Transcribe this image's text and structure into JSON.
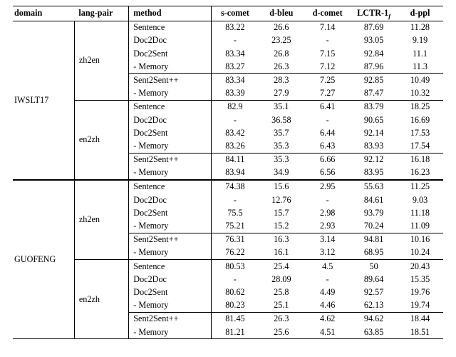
{
  "columns": {
    "c0": "domain",
    "c1": "lang-pair",
    "c2": "method",
    "c3": "s-comet",
    "c4": "d-bleu",
    "c5": "d-comet",
    "c6_prefix": "LCTR-1",
    "c6_sub": "f",
    "c7": "d-ppl"
  },
  "domains": [
    "IWSLT17",
    "GUOFENG"
  ],
  "langpairs": [
    "zh2en",
    "en2zh",
    "zh2en",
    "en2zh"
  ],
  "groups": [
    [
      [
        "Sentence",
        "83.22",
        "26.6",
        "7.14",
        "87.69",
        "11.28"
      ],
      [
        "Doc2Doc",
        "-",
        "23.25",
        "-",
        "93.05",
        "9.19"
      ],
      [
        "Doc2Sent",
        "83.34",
        "26.8",
        "7.15",
        "92.84",
        "11.1"
      ],
      [
        "  - Memory",
        "83.27",
        "26.3",
        "7.12",
        "87.96",
        "11.3"
      ]
    ],
    [
      [
        "Sent2Sent++",
        "83.34",
        "28.3",
        "7.25",
        "92.85",
        "10.49"
      ],
      [
        "  - Memory",
        "83.39",
        "27.9",
        "7.27",
        "87.47",
        "10.32"
      ]
    ],
    [
      [
        "Sentence",
        "82.9",
        "35.1",
        "6.41",
        "83.79",
        "18.25"
      ],
      [
        "Doc2Doc",
        "-",
        "36.58",
        "-",
        "90.65",
        "16.69"
      ],
      [
        "Doc2Sent",
        "83.42",
        "35.7",
        "6.44",
        "92.14",
        "17.53"
      ],
      [
        "  - Memory",
        "83.26",
        "35.3",
        "6.43",
        "83.93",
        "17.54"
      ]
    ],
    [
      [
        "Sent2Sent++",
        "84.11",
        "35.3",
        "6.66",
        "92.12",
        "16.18"
      ],
      [
        "  - Memory",
        "83.94",
        "34.9",
        "6.56",
        "83.95",
        "16.23"
      ]
    ],
    [
      [
        "Sentence",
        "74.38",
        "15.6",
        "2.95",
        "55.63",
        "11.25"
      ],
      [
        "Doc2Doc",
        "-",
        "12.76",
        "-",
        "84.61",
        "9.03"
      ],
      [
        "Doc2Sent",
        "75.5",
        "15.7",
        "2.98",
        "93.79",
        "11.18"
      ],
      [
        "  - Memory",
        "75.21",
        "15.2",
        "2.93",
        "70.24",
        "11.09"
      ]
    ],
    [
      [
        "Sent2Sent++",
        "76.31",
        "16.3",
        "3.14",
        "94.81",
        "10.16"
      ],
      [
        "  - Memory",
        "76.22",
        "16.1",
        "3.12",
        "68.95",
        "10.24"
      ]
    ],
    [
      [
        "Sentence",
        "80.53",
        "25.4",
        "4.5",
        "50",
        "20.43"
      ],
      [
        "Doc2Doc",
        "-",
        "28.09",
        "-",
        "89.64",
        "15.35"
      ],
      [
        "Doc2Sent",
        "80.62",
        "25.8",
        "4.49",
        "92.57",
        "19.76"
      ],
      [
        "  - Memory",
        "80.23",
        "25.1",
        "4.46",
        "62.13",
        "19.74"
      ]
    ],
    [
      [
        "Sent2Sent++",
        "81.45",
        "26.3",
        "4.62",
        "94.62",
        "18.44"
      ],
      [
        "  - Memory",
        "81.21",
        "25.6",
        "4.51",
        "63.85",
        "18.51"
      ]
    ]
  ],
  "chart_data": {
    "type": "table",
    "title": "",
    "columns": [
      "domain",
      "lang-pair",
      "method",
      "s-comet",
      "d-bleu",
      "d-comet",
      "LCTR-1_f",
      "d-ppl"
    ],
    "rows": [
      [
        "IWSLT17",
        "zh2en",
        "Sentence",
        83.22,
        26.6,
        7.14,
        87.69,
        11.28
      ],
      [
        "IWSLT17",
        "zh2en",
        "Doc2Doc",
        null,
        23.25,
        null,
        93.05,
        9.19
      ],
      [
        "IWSLT17",
        "zh2en",
        "Doc2Sent",
        83.34,
        26.8,
        7.15,
        92.84,
        11.1
      ],
      [
        "IWSLT17",
        "zh2en",
        "Doc2Sent - Memory",
        83.27,
        26.3,
        7.12,
        87.96,
        11.3
      ],
      [
        "IWSLT17",
        "zh2en",
        "Sent2Sent++",
        83.34,
        28.3,
        7.25,
        92.85,
        10.49
      ],
      [
        "IWSLT17",
        "zh2en",
        "Sent2Sent++ - Memory",
        83.39,
        27.9,
        7.27,
        87.47,
        10.32
      ],
      [
        "IWSLT17",
        "en2zh",
        "Sentence",
        82.9,
        35.1,
        6.41,
        83.79,
        18.25
      ],
      [
        "IWSLT17",
        "en2zh",
        "Doc2Doc",
        null,
        36.58,
        null,
        90.65,
        16.69
      ],
      [
        "IWSLT17",
        "en2zh",
        "Doc2Sent",
        83.42,
        35.7,
        6.44,
        92.14,
        17.53
      ],
      [
        "IWSLT17",
        "en2zh",
        "Doc2Sent - Memory",
        83.26,
        35.3,
        6.43,
        83.93,
        17.54
      ],
      [
        "IWSLT17",
        "en2zh",
        "Sent2Sent++",
        84.11,
        35.3,
        6.66,
        92.12,
        16.18
      ],
      [
        "IWSLT17",
        "en2zh",
        "Sent2Sent++ - Memory",
        83.94,
        34.9,
        6.56,
        83.95,
        16.23
      ],
      [
        "GUOFENG",
        "zh2en",
        "Sentence",
        74.38,
        15.6,
        2.95,
        55.63,
        11.25
      ],
      [
        "GUOFENG",
        "zh2en",
        "Doc2Doc",
        null,
        12.76,
        null,
        84.61,
        9.03
      ],
      [
        "GUOFENG",
        "zh2en",
        "Doc2Sent",
        75.5,
        15.7,
        2.98,
        93.79,
        11.18
      ],
      [
        "GUOFENG",
        "zh2en",
        "Doc2Sent - Memory",
        75.21,
        15.2,
        2.93,
        70.24,
        11.09
      ],
      [
        "GUOFENG",
        "zh2en",
        "Sent2Sent++",
        76.31,
        16.3,
        3.14,
        94.81,
        10.16
      ],
      [
        "GUOFENG",
        "zh2en",
        "Sent2Sent++ - Memory",
        76.22,
        16.1,
        3.12,
        68.95,
        10.24
      ],
      [
        "GUOFENG",
        "en2zh",
        "Sentence",
        80.53,
        25.4,
        4.5,
        50,
        20.43
      ],
      [
        "GUOFENG",
        "en2zh",
        "Doc2Doc",
        null,
        28.09,
        null,
        89.64,
        15.35
      ],
      [
        "GUOFENG",
        "en2zh",
        "Doc2Sent",
        80.62,
        25.8,
        4.49,
        92.57,
        19.76
      ],
      [
        "GUOFENG",
        "en2zh",
        "Doc2Sent - Memory",
        80.23,
        25.1,
        4.46,
        62.13,
        19.74
      ],
      [
        "GUOFENG",
        "en2zh",
        "Sent2Sent++",
        81.45,
        26.3,
        4.62,
        94.62,
        18.44
      ],
      [
        "GUOFENG",
        "en2zh",
        "Sent2Sent++ - Memory",
        81.21,
        25.6,
        4.51,
        63.85,
        18.51
      ]
    ]
  }
}
